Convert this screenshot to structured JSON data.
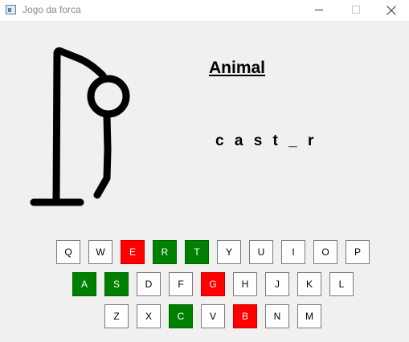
{
  "window": {
    "title": "Jogo da forca"
  },
  "game": {
    "category": "Animal",
    "word_display": "c a s t _ r",
    "wrong_guesses": 3
  },
  "keyboard": {
    "rows": [
      [
        {
          "letter": "Q",
          "state": "unused"
        },
        {
          "letter": "W",
          "state": "unused"
        },
        {
          "letter": "E",
          "state": "wrong"
        },
        {
          "letter": "R",
          "state": "correct"
        },
        {
          "letter": "T",
          "state": "correct"
        },
        {
          "letter": "Y",
          "state": "unused"
        },
        {
          "letter": "U",
          "state": "unused"
        },
        {
          "letter": "I",
          "state": "unused"
        },
        {
          "letter": "O",
          "state": "unused"
        },
        {
          "letter": "P",
          "state": "unused"
        }
      ],
      [
        {
          "letter": "A",
          "state": "correct"
        },
        {
          "letter": "S",
          "state": "correct"
        },
        {
          "letter": "D",
          "state": "unused"
        },
        {
          "letter": "F",
          "state": "unused"
        },
        {
          "letter": "G",
          "state": "wrong"
        },
        {
          "letter": "H",
          "state": "unused"
        },
        {
          "letter": "J",
          "state": "unused"
        },
        {
          "letter": "K",
          "state": "unused"
        },
        {
          "letter": "L",
          "state": "unused"
        }
      ],
      [
        {
          "letter": "Z",
          "state": "unused"
        },
        {
          "letter": "X",
          "state": "unused"
        },
        {
          "letter": "C",
          "state": "correct"
        },
        {
          "letter": "V",
          "state": "unused"
        },
        {
          "letter": "B",
          "state": "wrong"
        },
        {
          "letter": "N",
          "state": "unused"
        },
        {
          "letter": "M",
          "state": "unused"
        }
      ]
    ]
  },
  "colors": {
    "correct": "#008000",
    "wrong": "#ff0000",
    "unused": "#ffffff",
    "background": "#f0f0f0"
  }
}
